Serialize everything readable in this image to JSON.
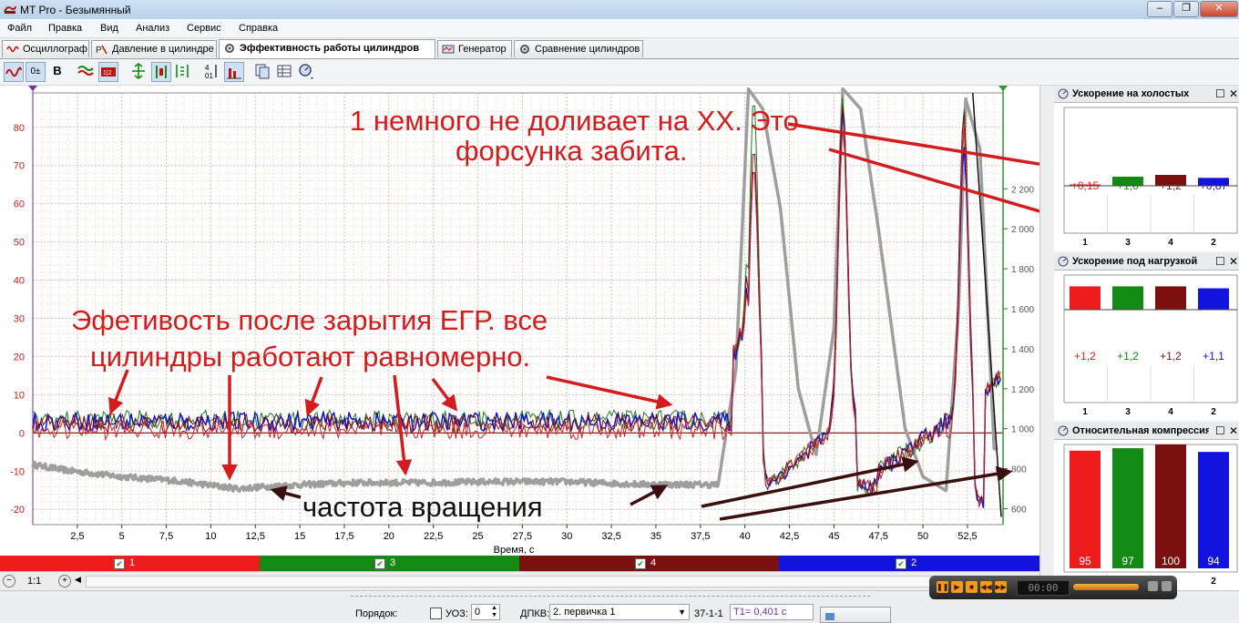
{
  "window": {
    "title": "MT Pro - Безымянный",
    "minimize": "–",
    "maximize": "❐",
    "close": "✕"
  },
  "menu": [
    "Файл",
    "Правка",
    "Вид",
    "Анализ",
    "Сервис",
    "Справка"
  ],
  "tabs": [
    {
      "label": "Осциллограф",
      "icon": "waveform-icon"
    },
    {
      "label": "Давление в цилиндре",
      "icon": "pressure-icon"
    },
    {
      "label": "Эффективность работы цилиндров",
      "icon": "gear-icon",
      "active": true
    },
    {
      "label": "Генератор",
      "icon": "generator-icon"
    },
    {
      "label": "Сравнение цилиндров",
      "icon": "compare-icon"
    }
  ],
  "toolbar": {
    "bold_label": "B",
    "offset_label": "0±"
  },
  "chart_data": {
    "type": "line",
    "xlabel": "Время, с",
    "x_ticks": [
      "2,5",
      "5",
      "7,5",
      "10",
      "12,5",
      "15",
      "17,5",
      "20",
      "22,5",
      "25",
      "27,5",
      "30",
      "32,5",
      "35",
      "37,5",
      "40",
      "42,5",
      "45",
      "47,5",
      "50",
      "52,5"
    ],
    "x_tick_values": [
      2.5,
      5,
      7.5,
      10,
      12.5,
      15,
      17.5,
      20,
      22.5,
      25,
      27.5,
      30,
      32.5,
      35,
      37.5,
      40,
      42.5,
      45,
      47.5,
      50,
      52.5
    ],
    "xlim": [
      0,
      54.5
    ],
    "left_axis": {
      "ticks": [
        "80",
        "70",
        "60",
        "50",
        "40",
        "30",
        "20",
        "10",
        "0",
        "-10",
        "-20"
      ],
      "values": [
        80,
        70,
        60,
        50,
        40,
        30,
        20,
        10,
        0,
        -10,
        -20
      ],
      "ylim": [
        -24,
        89
      ]
    },
    "right_axis": {
      "ticks": [
        "2 200",
        "2 000",
        "1 800",
        "1 600",
        "1 400",
        "1 200",
        "1 000",
        "800",
        "600"
      ],
      "values": [
        2200,
        2000,
        1800,
        1600,
        1400,
        1200,
        1000,
        800,
        600
      ],
      "ylim": [
        520,
        2680
      ]
    },
    "series": [
      {
        "color": "#1a7f1a",
        "baseline": 3.5,
        "axis": "left",
        "peaks": [
          [
            40.5,
            88
          ],
          [
            45.5,
            88
          ],
          [
            52.3,
            85
          ]
        ]
      },
      {
        "color": "#1515c8",
        "baseline": 3.0,
        "axis": "left",
        "peaks": [
          [
            40.5,
            70
          ],
          [
            45.5,
            85
          ],
          [
            52.3,
            75
          ]
        ]
      },
      {
        "color": "#7a0e0e",
        "baseline": 2.5,
        "axis": "left",
        "peaks": [
          [
            40.5,
            75
          ],
          [
            45.5,
            86
          ],
          [
            52.3,
            84
          ]
        ]
      },
      {
        "color": "#d42020",
        "baseline": 0.8,
        "axis": "left",
        "peaks": [
          [
            40.5,
            70
          ],
          [
            45.5,
            80
          ],
          [
            52.3,
            80
          ]
        ]
      }
    ],
    "rpm_series": {
      "color": "#9e9e9e",
      "axis": "right",
      "points": [
        [
          0,
          820
        ],
        [
          2,
          790
        ],
        [
          5,
          760
        ],
        [
          8,
          740
        ],
        [
          11.5,
          700
        ],
        [
          14,
          715
        ],
        [
          18,
          730
        ],
        [
          22,
          730
        ],
        [
          26,
          735
        ],
        [
          30,
          735
        ],
        [
          34,
          722
        ],
        [
          38.5,
          720
        ],
        [
          39.5,
          1300
        ],
        [
          40.2,
          2700
        ],
        [
          41,
          2600
        ],
        [
          42,
          2100
        ],
        [
          43,
          1200
        ],
        [
          44,
          870
        ],
        [
          45,
          1500
        ],
        [
          45.5,
          2700
        ],
        [
          46.5,
          2600
        ],
        [
          47.5,
          2000
        ],
        [
          49,
          1000
        ],
        [
          50,
          760
        ],
        [
          51.3,
          690
        ],
        [
          52,
          1600
        ],
        [
          52.4,
          2650
        ],
        [
          53.2,
          2400
        ],
        [
          54,
          900
        ]
      ]
    }
  },
  "annotations": {
    "top_line1": "1 немного не доливает на ХХ. Это",
    "top_line2": "форсунка забита.",
    "mid_line1": "Эфетивость после зарытия ЕГР. все",
    "mid_line2": "цилиндры работают  равномерно.",
    "freq": "частота вращения"
  },
  "channels": [
    {
      "label": "1",
      "color": "#ee1c1c"
    },
    {
      "label": "3",
      "color": "#138a13"
    },
    {
      "label": "4",
      "color": "#7a1010"
    },
    {
      "label": "2",
      "color": "#1313e0"
    }
  ],
  "zoom": {
    "ratio": "1:1"
  },
  "status": {
    "order_label": "Порядок:",
    "uoz_label": "УОЗ:",
    "uoz_value": "0",
    "dpkv_label": "ДПКВ:",
    "dpkv_value": "2. первичка 1",
    "code": "37-1-1",
    "t1": "T1= 0,401 c"
  },
  "panels": [
    {
      "title": "Ускорение на холостых",
      "bars": [
        {
          "cyl": "1",
          "label": "+0,15",
          "value": 0.15,
          "color": "#ee1c1c"
        },
        {
          "cyl": "3",
          "label": "+1,0",
          "value": 1.0,
          "color": "#138a13"
        },
        {
          "cyl": "4",
          "label": "+1,2",
          "value": 1.2,
          "color": "#7a1010"
        },
        {
          "cyl": "2",
          "label": "+0,87",
          "value": 0.87,
          "color": "#1313e0"
        }
      ]
    },
    {
      "title": "Ускорение под нагрузкой",
      "bars": [
        {
          "cyl": "1",
          "label": "+1,2",
          "value": 1.2,
          "color": "#ee1c1c"
        },
        {
          "cyl": "3",
          "label": "+1,2",
          "value": 1.2,
          "color": "#138a13"
        },
        {
          "cyl": "4",
          "label": "+1,2",
          "value": 1.2,
          "color": "#7a1010"
        },
        {
          "cyl": "2",
          "label": "+1,1",
          "value": 1.1,
          "color": "#1313e0"
        }
      ]
    },
    {
      "title": "Относительная компрессия",
      "bars": [
        {
          "cyl": "1",
          "label": "95",
          "value": 95,
          "color": "#ee1c1c"
        },
        {
          "cyl": "3",
          "label": "97",
          "value": 97,
          "color": "#138a13"
        },
        {
          "cyl": "4",
          "label": "100",
          "value": 100,
          "color": "#7a1010"
        },
        {
          "cyl": "2",
          "label": "94",
          "value": 94,
          "color": "#1313e0"
        }
      ]
    }
  ],
  "media": {
    "time": "00:00"
  }
}
